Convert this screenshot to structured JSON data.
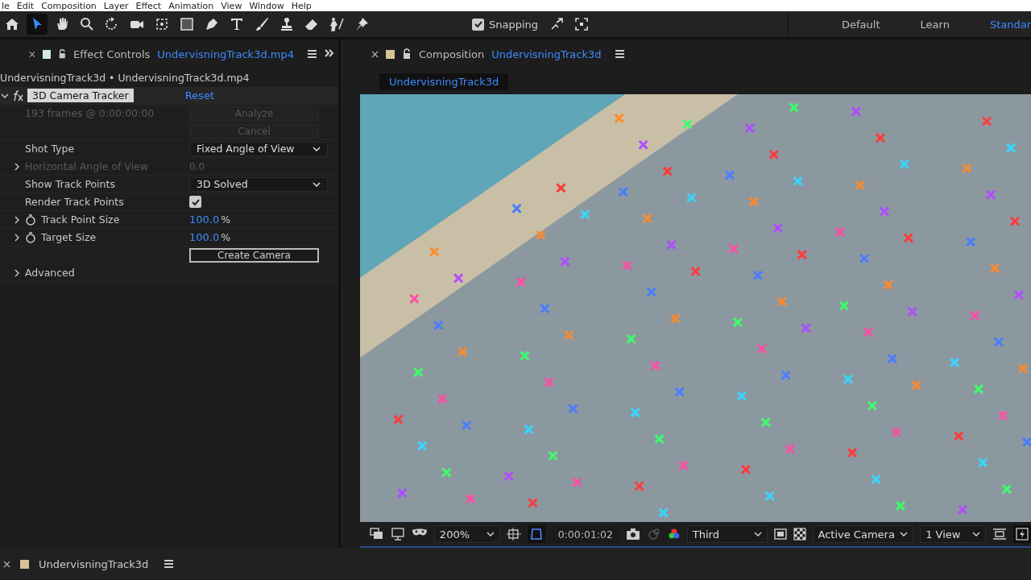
{
  "menu_bar": {
    "items": [
      "le",
      "Edit",
      "Composition",
      "Layer",
      "Effect",
      "Animation",
      "View",
      "Window",
      "Help"
    ]
  },
  "toolbar": {
    "tools": [
      {
        "kind": "home",
        "selected": false
      },
      {
        "kind": "select",
        "selected": true
      },
      {
        "kind": "hand",
        "selected": false
      },
      {
        "kind": "zoom",
        "selected": false
      },
      {
        "kind": "rotate",
        "selected": false
      },
      {
        "kind": "camera",
        "selected": false
      },
      {
        "kind": "pan",
        "selected": false
      },
      {
        "kind": "rect",
        "selected": false
      },
      {
        "kind": "pen",
        "selected": false
      },
      {
        "kind": "type",
        "selected": false
      },
      {
        "kind": "brush",
        "selected": false
      },
      {
        "kind": "stamp",
        "selected": false
      },
      {
        "kind": "eraser",
        "selected": false
      },
      {
        "kind": "puppet",
        "selected": false
      },
      {
        "kind": "pin",
        "selected": false
      }
    ],
    "snapping": {
      "label": "Snapping",
      "checked": true
    },
    "workspaces": [
      {
        "label": "Default",
        "selected": false
      },
      {
        "label": "Learn",
        "selected": false
      },
      {
        "label": "Standar",
        "selected": true
      }
    ]
  },
  "effect_controls": {
    "tab_title": "Effect Controls",
    "tab_target": "UndervisningTrack3d.mp4",
    "breadcrumb": "UndervisningTrack3d • UndervisningTrack3d.mp4",
    "effect": {
      "name": "3D Camera Tracker",
      "reset": "Reset",
      "expanded": true
    },
    "rows": [
      {
        "kind": "info",
        "label": "193 frames @ 0:00:00:00",
        "button": "Analyze",
        "disabled": true
      },
      {
        "kind": "button",
        "button": "Cancel",
        "disabled": true
      },
      {
        "kind": "dropdown",
        "label": "Shot Type",
        "value": "Fixed Angle of View",
        "disabled": false
      },
      {
        "kind": "value",
        "label": "Horizontal Angle of View",
        "value": "0.0",
        "disabled": true
      },
      {
        "kind": "dropdown",
        "label": "Show Track Points",
        "value": "3D Solved",
        "disabled": false
      },
      {
        "kind": "checkbox",
        "label": "Render Track Points",
        "checked": true,
        "disabled": false
      },
      {
        "kind": "percent",
        "label": "Track Point Size",
        "value": "100.0",
        "unit": "%",
        "disabled": false
      },
      {
        "kind": "percent",
        "label": "Target Size",
        "value": "100.0",
        "unit": "%",
        "disabled": false
      },
      {
        "kind": "button",
        "button": "Create Camera",
        "disabled": false
      },
      {
        "kind": "group",
        "label": "Advanced",
        "disabled": false
      }
    ]
  },
  "composition": {
    "tab_title": "Composition",
    "tab_target": "UndervisningTrack3d",
    "comp_tab": "UndervisningTrack3d",
    "viewer_toolbar": {
      "zoom": "200%",
      "timecode": "0:00:01:02",
      "resolution": "Third",
      "camera": "Active Camera",
      "views": "1 View"
    }
  },
  "timeline": {
    "tab_title": "UndervisningTrack3d"
  }
}
